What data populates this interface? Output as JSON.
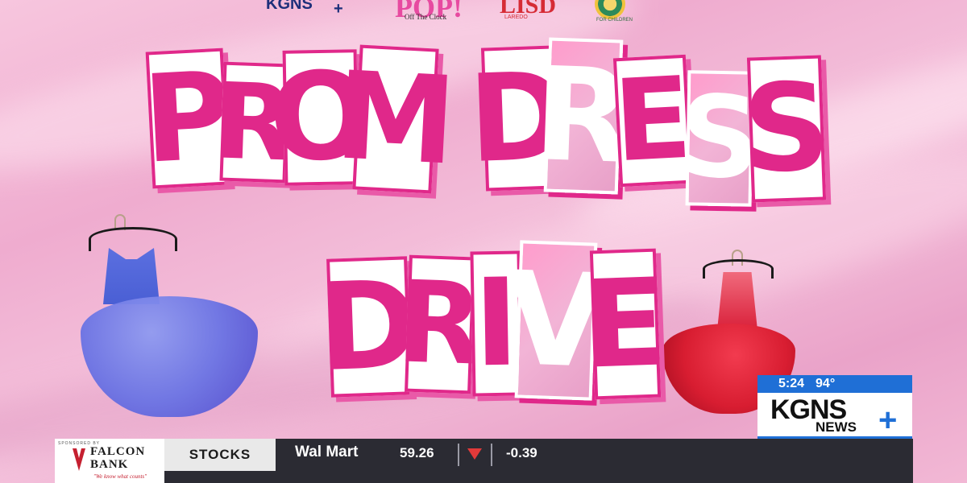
{
  "logos": {
    "kgns": "KGNS",
    "kgns_plus": "+",
    "pop": "POP!",
    "pop_sub": "Off The Clock",
    "lisd": "LISD",
    "lisd_sub": "LAREDO",
    "seal_sub": "FOR CHILDREN"
  },
  "headline": {
    "line1_word1": [
      "P",
      "R",
      "O",
      "M"
    ],
    "line1_word2": [
      "D",
      "R",
      "E",
      "S",
      "S"
    ],
    "line2": [
      "D",
      "R",
      "I",
      "V",
      "E"
    ]
  },
  "ticker": {
    "sponsor": {
      "top_text": "SPONSORED BY",
      "name_line1": "FALCON",
      "name_line2": "BANK",
      "tagline": "\"We know what counts\""
    },
    "section_label": "STOCKS",
    "company": "Wal Mart",
    "price": "59.26",
    "change": "-0.39",
    "down_color": "#e23a3a"
  },
  "bug": {
    "time": "5:24",
    "temperature": "94°",
    "brand": "KGNS",
    "sub": "NEWS",
    "plus": "+",
    "accent": "#1f6fd6"
  },
  "colors": {
    "headline_pink": "#e0288a",
    "background_pink": "#f3b9d6"
  }
}
